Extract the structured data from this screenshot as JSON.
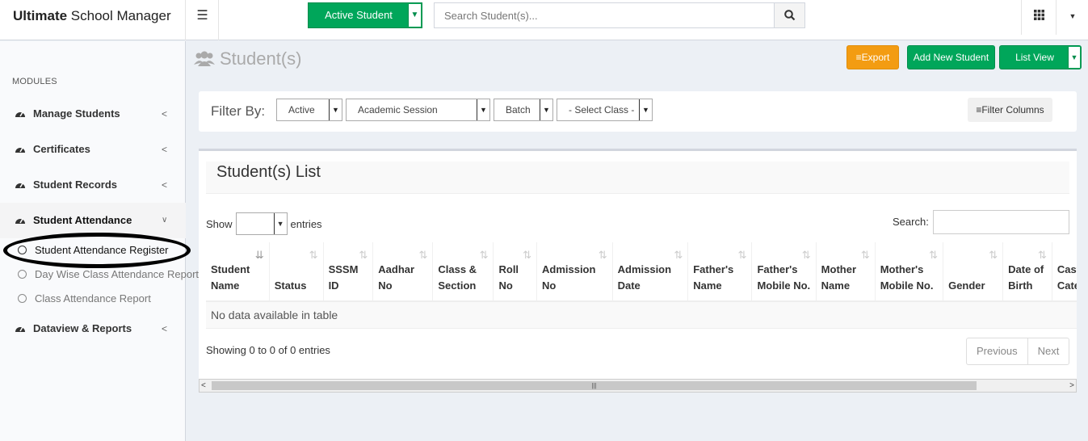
{
  "brand": {
    "bold": "Ultimate",
    "rest": " School Manager"
  },
  "topbar": {
    "active_student": "Active Student",
    "search_placeholder": "Search Student(s)..."
  },
  "sidebar": {
    "header": "MODULES",
    "items": [
      {
        "label": "Manage Students",
        "icon": "dashboard-icon"
      },
      {
        "label": "Certificates",
        "icon": "dashboard-icon"
      },
      {
        "label": "Student Records",
        "icon": "dashboard-icon"
      },
      {
        "label": "Student Attendance",
        "icon": "dashboard-icon"
      }
    ],
    "subitems": [
      {
        "label": "Student Attendance Register"
      },
      {
        "label": "Day Wise Class Attendance Report"
      },
      {
        "label": "Class Attendance Report"
      }
    ],
    "last_item": {
      "label": "Dataview & Reports",
      "icon": "dashboard-icon"
    }
  },
  "page": {
    "title": "Student(s)"
  },
  "actions": {
    "export": "Export",
    "add": "Add New Student",
    "list_view": "List View"
  },
  "filter": {
    "label": "Filter By:",
    "status": "Active",
    "session": "Academic Session",
    "batch": "Batch",
    "class": "- Select Class -",
    "columns": "Filter Columns"
  },
  "list": {
    "title": "Student(s) List",
    "show": "Show",
    "entries": "entries",
    "search": "Search:",
    "columns": [
      "Student Name",
      "Status",
      "SSSM ID",
      "Aadhar No",
      "Class & Section",
      "Roll No",
      "Admission No",
      "Admission Date",
      "Father's Name",
      "Father's Mobile No.",
      "Mother Name",
      "Mother's Mobile No.",
      "Gender",
      "Date of Birth",
      "Caste Category"
    ],
    "empty": "No data available in table",
    "info": "Showing 0 to 0 of 0 entries",
    "previous": "Previous",
    "next": "Next"
  },
  "colors": {
    "green": "#00a65a",
    "orange": "#f39c12"
  }
}
